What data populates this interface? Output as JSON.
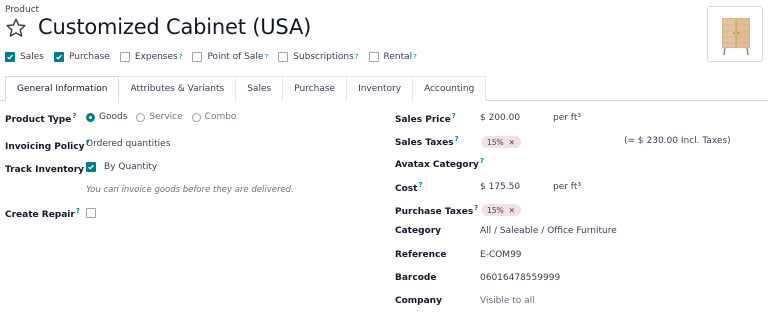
{
  "header": {
    "breadcrumb": "Product",
    "title": "Customized Cabinet (USA)",
    "image_alt": "product-image"
  },
  "options": [
    {
      "label": "Sales",
      "checked": true,
      "help": false
    },
    {
      "label": "Purchase",
      "checked": true,
      "help": false
    },
    {
      "label": "Expenses",
      "checked": false,
      "help": true
    },
    {
      "label": "Point of Sale",
      "checked": false,
      "help": true
    },
    {
      "label": "Subscriptions",
      "checked": false,
      "help": true
    },
    {
      "label": "Rental",
      "checked": false,
      "help": true
    }
  ],
  "tabs": [
    "General Information",
    "Attributes & Variants",
    "Sales",
    "Purchase",
    "Inventory",
    "Accounting"
  ],
  "help_mark": "?",
  "left": {
    "product_type_label": "Product Type",
    "product_type_options": [
      "Goods",
      "Service",
      "Combo"
    ],
    "product_type_selected": "Goods",
    "invoicing_policy_label": "Invoicing Policy",
    "invoicing_policy_value": "Ordered quantities",
    "track_inventory_label": "Track Inventory",
    "track_inventory_value": "By Quantity",
    "invoice_note": "You can invoice goods before they are delivered.",
    "create_repair_label": "Create Repair"
  },
  "right": {
    "sales_price_label": "Sales Price",
    "sales_price_value": "$ 200.00",
    "sales_price_unit": "per ft³",
    "sales_taxes_label": "Sales Taxes",
    "sales_taxes_tag": "15%",
    "sales_taxes_incl": "(= $ 230.00 Incl. Taxes)",
    "avatax_label": "Avatax Category",
    "cost_label": "Cost",
    "cost_value": "$ 175.50",
    "cost_unit": "per ft³",
    "purchase_taxes_label": "Purchase Taxes",
    "purchase_taxes_tag": "15%",
    "category_label": "Category",
    "category_value": "All / Saleable / Office Furniture",
    "reference_label": "Reference",
    "reference_value": "E-COM99",
    "barcode_label": "Barcode",
    "barcode_value": "06016478559999",
    "company_label": "Company",
    "company_placeholder": "Visible to all"
  },
  "colors": {
    "accent": "#017e84",
    "tag_bg": "#f2e0e2"
  }
}
